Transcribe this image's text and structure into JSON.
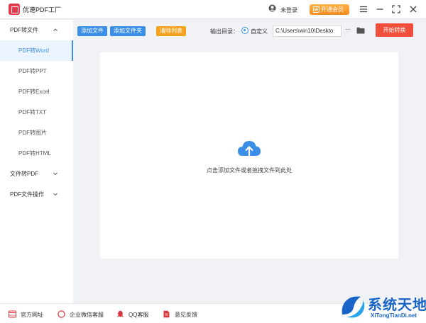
{
  "app": {
    "title": "优速PDF工厂"
  },
  "titlebar": {
    "login_text": "未登录",
    "vip_label": "开通会员"
  },
  "sidebar": {
    "groups": [
      {
        "label": "PDF转文件",
        "expanded": true
      },
      {
        "label": "文件转PDF",
        "expanded": false
      },
      {
        "label": "PDF文件操作",
        "expanded": false
      }
    ],
    "items": [
      {
        "label": "PDF转Word",
        "active": true
      },
      {
        "label": "PDF转PPT"
      },
      {
        "label": "PDF转Excel"
      },
      {
        "label": "PDF转TXT"
      },
      {
        "label": "PDF转图片"
      },
      {
        "label": "PDF转HTML"
      }
    ]
  },
  "toolbar": {
    "add_file": "添加文件",
    "add_folder": "添加文件夹",
    "clear_list": "清除列表",
    "output_label": "输出目录：",
    "custom_label": "自定义",
    "output_path": "C:\\Users\\win10\\Deskto",
    "more": "···",
    "start": "开始转换"
  },
  "dropzone": {
    "hint": "点击添加文件或者拖拽文件到此处"
  },
  "footer": {
    "items": [
      {
        "label": "官方网址",
        "icon": "website-icon"
      },
      {
        "label": "企业微信客服",
        "icon": "wechat-work-icon"
      },
      {
        "label": "QQ客服",
        "icon": "qq-icon"
      },
      {
        "label": "意见反馈",
        "icon": "feedback-icon"
      }
    ]
  },
  "watermark": {
    "title": "系统天地",
    "url": "XiTongTianDi.net"
  },
  "colors": {
    "accent": "#3a8ee6",
    "start": "#f0503a",
    "vip": "#f48a1e",
    "brand": "#e5394b"
  }
}
